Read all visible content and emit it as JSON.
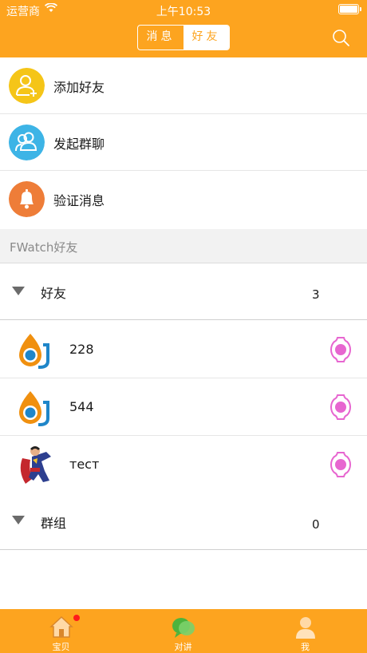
{
  "status_bar": {
    "carrier": "运营商",
    "time": "上午10:53"
  },
  "header": {
    "tabs": [
      "消息",
      "好友"
    ],
    "active_tab": "好友"
  },
  "menu": [
    {
      "label": "添加好友",
      "icon": "add-user-icon",
      "color": "#f5c518"
    },
    {
      "label": "发起群聊",
      "icon": "group-chat-icon",
      "color": "#3db4e6"
    },
    {
      "label": "验证消息",
      "icon": "bell-icon",
      "color": "#ee7d38"
    }
  ],
  "section_title": "FWatch好友",
  "friends_group": {
    "label": "好友",
    "count": "3"
  },
  "friends": [
    {
      "name": "228",
      "avatar": "watch-logo-icon"
    },
    {
      "name": "544",
      "avatar": "watch-logo-icon"
    },
    {
      "name": "тест",
      "avatar": "superman-avatar"
    }
  ],
  "groups_group": {
    "label": "群组",
    "count": "0"
  },
  "tabbar": [
    {
      "label": "宝贝",
      "icon": "home-icon"
    },
    {
      "label": "对讲",
      "icon": "chat-bubbles-icon"
    },
    {
      "label": "我",
      "icon": "profile-icon"
    }
  ],
  "colors": {
    "brand": "#fda41f",
    "device": "#e766d0"
  }
}
